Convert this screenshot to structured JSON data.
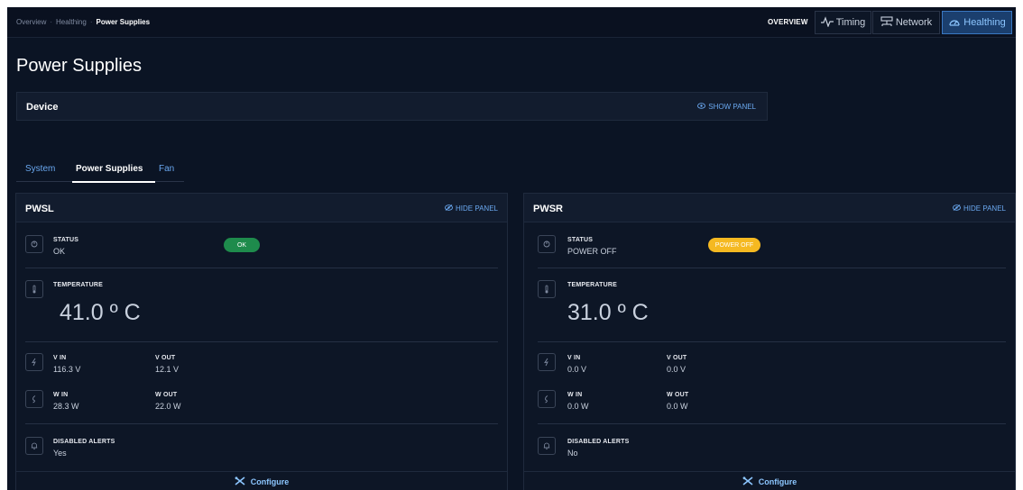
{
  "breadcrumb": {
    "items": [
      "Overview",
      "Healthing"
    ],
    "separator": "·",
    "current": "Power Supplies"
  },
  "nav": {
    "overview_label": "OVERVIEW",
    "timing_label": "Timing",
    "network_label": "Network",
    "healthing_label": "Healthing"
  },
  "page_title": "Power Supplies",
  "device": {
    "title": "Device",
    "show_panel_label": "SHOW PANEL"
  },
  "tabs": [
    {
      "label": "System",
      "active": false
    },
    {
      "label": "Power Supplies",
      "active": true
    },
    {
      "label": "Fan",
      "active": false
    }
  ],
  "cards": [
    {
      "title": "PWSL",
      "hide_panel_label": "HIDE PANEL",
      "status_label": "STATUS",
      "status_value": "OK",
      "status_badge": "OK",
      "temperature_label": "TEMPERATURE",
      "temperature_value": "41.0 º C",
      "vin_label": "V IN",
      "vin_value": "116.3 V",
      "vout_label": "V OUT",
      "vout_value": "12.1 V",
      "win_label": "W IN",
      "win_value": "28.3 W",
      "wout_label": "W OUT",
      "wout_value": "22.0 W",
      "alerts_label": "DISABLED ALERTS",
      "alerts_value": "Yes",
      "configure_label": "Configure"
    },
    {
      "title": "PWSR",
      "hide_panel_label": "HIDE PANEL",
      "status_label": "STATUS",
      "status_value": "POWER OFF",
      "status_badge": "POWER OFF",
      "temperature_label": "TEMPERATURE",
      "temperature_value": "31.0 º C",
      "vin_label": "V IN",
      "vin_value": "0.0 V",
      "vout_label": "V OUT",
      "vout_value": "0.0 V",
      "win_label": "W IN",
      "win_value": "0.0 W",
      "wout_label": "W OUT",
      "wout_value": "0.0 W",
      "alerts_label": "DISABLED ALERTS",
      "alerts_value": "No",
      "configure_label": "Configure"
    }
  ],
  "colors": {
    "background": "#0b1424",
    "accent": "#6aa8f0",
    "ok_badge": "#1e8b4c",
    "power_off_badge": "#f5b921",
    "active_nav": "#1b3f6e"
  },
  "icons": {
    "timing": "pulse-icon",
    "network": "network-icon",
    "healthing": "gauge-icon",
    "panel_toggle": "eye-icon",
    "status": "power-icon",
    "temperature": "thermometer-icon",
    "voltage": "bolt-icon",
    "watts": "plug-icon",
    "alerts": "bell-icon",
    "configure": "tools-icon"
  }
}
